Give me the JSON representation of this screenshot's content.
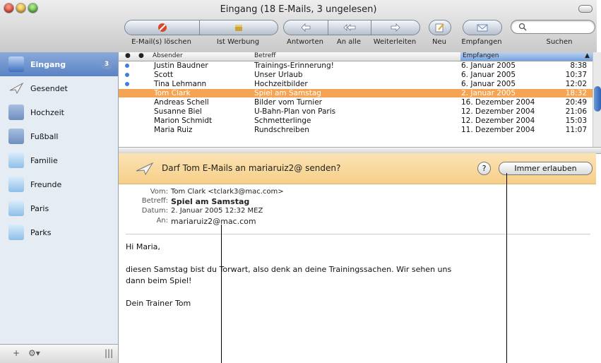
{
  "window": {
    "title": "Eingang (18 E-Mails, 3 ungelesen)"
  },
  "toolbar": {
    "delete_label": "E-Mail(s) löschen",
    "junk_label": "Ist Werbung",
    "reply_label": "Antworten",
    "reply_all_label": "An alle",
    "forward_label": "Weiterleiten",
    "new_label": "Neu",
    "get_mail_label": "Empfangen",
    "search_label": "Suchen"
  },
  "sidebar": {
    "items": [
      {
        "label": "Eingang",
        "badge": "3",
        "selected": true
      },
      {
        "label": "Gesendet"
      },
      {
        "label": "Hochzeit"
      },
      {
        "label": "Fußball"
      },
      {
        "label": "Familie"
      },
      {
        "label": "Freunde"
      },
      {
        "label": "Paris"
      },
      {
        "label": "Parks"
      }
    ]
  },
  "list": {
    "columns": {
      "sender": "Absender",
      "subject": "Betreff",
      "received": "Empfangen"
    },
    "rows": [
      {
        "sender": "Justin Baudner",
        "subject": "Trainings-Erinnerung!",
        "date": "6. Januar 2005",
        "time": "8:38",
        "unread": true
      },
      {
        "sender": "Scott",
        "subject": "Unser Urlaub",
        "date": "6. Januar 2005",
        "time": "10:37",
        "unread": true
      },
      {
        "sender": "Tina Lehmann",
        "subject": "Hochzeitbilder",
        "date": "6. Januar 2005",
        "time": "12:02",
        "unread": true
      },
      {
        "sender": "Tom Clark",
        "subject": "Spiel am Samstag",
        "date": "2. Januar 2005",
        "time": "18:32",
        "selected": true
      },
      {
        "sender": "Andreas Schell",
        "subject": "Bilder vom Turnier",
        "date": "16. Dezember 2004",
        "time": "20:49"
      },
      {
        "sender": "Susanne Biel",
        "subject": "U-Bahn-Plan von Paris",
        "date": "12. Dezember 2004",
        "time": "21:06"
      },
      {
        "sender": "Marion Schmidt",
        "subject": "Schmetterlinge",
        "date": "12. Dezember 2004",
        "time": "15:03"
      },
      {
        "sender": "Maria Ruiz",
        "subject": "Rundschreiben",
        "date": "11. Dezember 2004",
        "time": "11:07"
      }
    ]
  },
  "notice": {
    "text": "Darf Tom E-Mails an mariaruiz2@ senden?",
    "help": "?",
    "allow_button": "Immer erlauben"
  },
  "message": {
    "from_key": "Vom:",
    "from": "Tom Clark <tclark3@mac.com>",
    "subject_key": "Betreff:",
    "subject": "Spiel am Samstag",
    "date_key": "Datum:",
    "date": "2. Januar 2005 12:32 MEZ",
    "to_key": "An:",
    "to": "mariaruiz2@mac.com",
    "greeting": "Hi Maria,",
    "body": "diesen Samstag bist du Torwart, also denk an deine Trainingssachen. Wir sehen uns dann beim Spiel!",
    "signature": "Dein Trainer Tom"
  },
  "colors": {
    "selected_row": "#f5a454",
    "notice_bg": "#f6cf88",
    "sidebar_selected": "#5a83c4"
  }
}
